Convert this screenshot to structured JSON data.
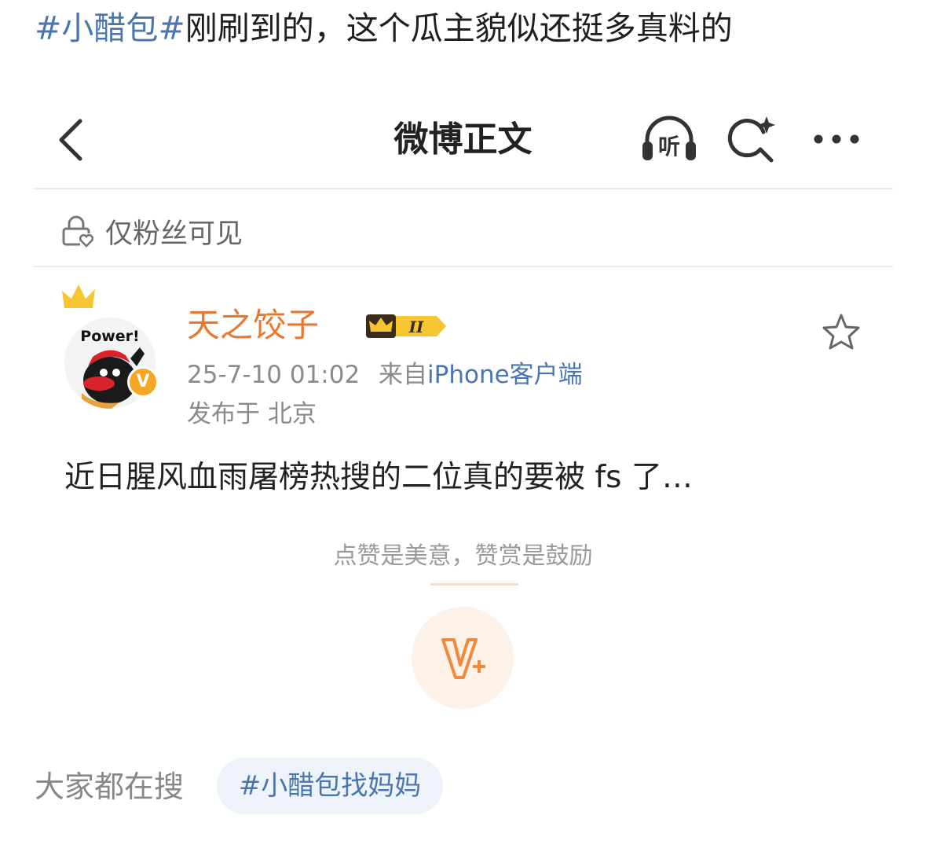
{
  "header_text": {
    "hashtag": "#小醋包#",
    "text": "刚刷到的，这个瓜主貌似还挺多真料的"
  },
  "nav": {
    "title": "微博正文",
    "listen_label": "听",
    "back_icon": "chevron-left-icon",
    "search_icon": "search-sparkle-icon",
    "more_icon": "more-dots-icon"
  },
  "visibility": {
    "label": "仅粉丝可见",
    "icon": "lock-heart-icon"
  },
  "post": {
    "avatar_text": "Power!",
    "username": "天之饺子",
    "level_badge": "II",
    "verified_badge": "V",
    "time": "25-7-10 01:02",
    "from_prefix": "来自",
    "client": "iPhone客户端",
    "location": "发布于 北京",
    "content": "近日腥风血雨屠榜热搜的二位真的要被 fs 了…"
  },
  "reward": {
    "tip": "点赞是美意，赞赏是鼓励",
    "icon": "v-plus-icon"
  },
  "trending": {
    "label": "大家都在搜",
    "tag": "#小醋包找妈妈"
  },
  "colors": {
    "link_blue": "#4a76b0",
    "username_orange": "#e8782b",
    "reward_bg": "#fdf1e8",
    "pill_bg": "#eef3f9"
  }
}
